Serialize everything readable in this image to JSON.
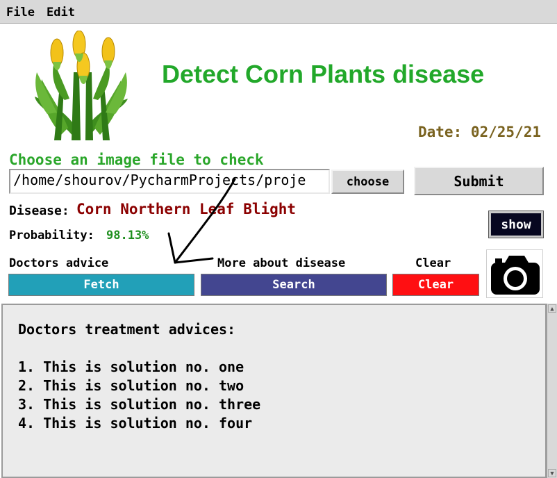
{
  "menu": {
    "items": [
      "File",
      "Edit"
    ]
  },
  "app": {
    "title": "Detect Corn Plants disease",
    "date_label": "Date: ",
    "date_value": "02/25/21"
  },
  "colors": {
    "title_green": "#22a82a",
    "label_green": "#2aa62a",
    "date_brown": "#7a6320",
    "disease_red": "#8b0000",
    "prob_green": "#1f8f1f",
    "fetch_teal": "#22a0b8",
    "search_indigo": "#434690",
    "clear_red": "#ff0f12"
  },
  "file": {
    "prompt": "Choose an image file to check",
    "path_value": "/home/shourov/PycharmProjects/proje",
    "choose_label": "choose",
    "submit_label": "Submit"
  },
  "result": {
    "disease_label": "Disease:",
    "disease_value": "Corn Northern Leaf Blight",
    "probability_label": "Probability:",
    "probability_value": "98.13%",
    "show_label": "show"
  },
  "actions": {
    "doctors_label": "Doctors advice",
    "fetch_label": "Fetch",
    "more_label": "More about disease",
    "search_label": "Search",
    "clear_caption": "Clear",
    "clear_label": "Clear",
    "camera_icon": "camera-icon"
  },
  "advice": {
    "heading": "Doctors treatment advices:",
    "items": [
      "1. This is solution no. one",
      "2. This is solution no. two",
      "3. This is solution no. three",
      "4. This is solution no. four"
    ]
  }
}
